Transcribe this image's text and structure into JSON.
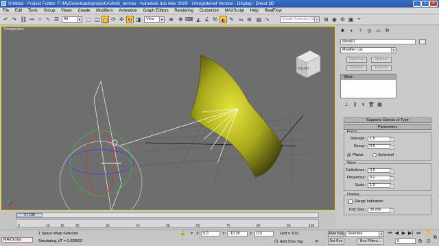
{
  "window": {
    "title": "Untitled    - Project Folder: F:\\MyDownloads\\project\\Ashish_termax    - Autodesk 3ds Max  2009    - Unregistered Version    - Display : Direct 3D"
  },
  "menu": [
    "File",
    "Edit",
    "Tools",
    "Group",
    "Views",
    "Create",
    "Modifiers",
    "Animation",
    "Graph Editors",
    "Rendering",
    "Customize",
    "MAXScript",
    "Help",
    "RealFlow"
  ],
  "toolbar": {
    "filter": "All",
    "view": "View",
    "named_sel_placeholder": "Create Selection Set"
  },
  "viewport": {
    "label": "Perspective",
    "viewcube_face": "FRONT"
  },
  "command_panel": {
    "object_name": "Wind01",
    "modifier_list": "Modifier List",
    "buttons": [
      "Edit Poly",
      "Normal",
      "Material",
      "Extrude"
    ],
    "stack_item": "Wind",
    "rollout_supports": "Supports Objects of Type",
    "rollout_params": "Parameters",
    "force_group": "Force",
    "strength_label": "Strength:",
    "strength": "1.5",
    "decay_label": "Decay:",
    "decay": "0.0",
    "planar": "Planar",
    "spherical": "Spherical",
    "wind_group": "Wind",
    "turbulence_label": "Turbulence:",
    "turbulence": "0.5",
    "frequency_label": "Frequency:",
    "frequency": "0.2",
    "scale_label": "Scale:",
    "scale": "1.0",
    "display_group": "Display",
    "range_indicators": "Range Indicators",
    "icon_size_label": "Icon Size:",
    "icon_size": "38.956"
  },
  "timeline": {
    "frame": "0 / 100",
    "ticks": [
      "0",
      "10",
      "15",
      "20",
      "30",
      "40",
      "50",
      "60",
      "70",
      "80",
      "90",
      "100"
    ]
  },
  "status": {
    "maxscript": "MAXScript.",
    "selection": "1 Space Warp Selected",
    "prompt": "Simulating, dT = 0.020000",
    "x_label": "X:",
    "x": "0.0",
    "y_label": "Y:",
    "y": "-10.28",
    "z_label": "Z:",
    "z": "0.0",
    "grid": "Grid = 10.0",
    "add_time_tag": "Add Time Tag",
    "auto_key": "Auto Key",
    "set_key": "Set Key",
    "key_mode": "Selected",
    "key_filters": "Key Filters...",
    "current_frame": "0"
  },
  "colors": {
    "viewport_bg": "#6e6e6e",
    "active_border": "#ffd400",
    "mesh": "#c7c72c"
  }
}
